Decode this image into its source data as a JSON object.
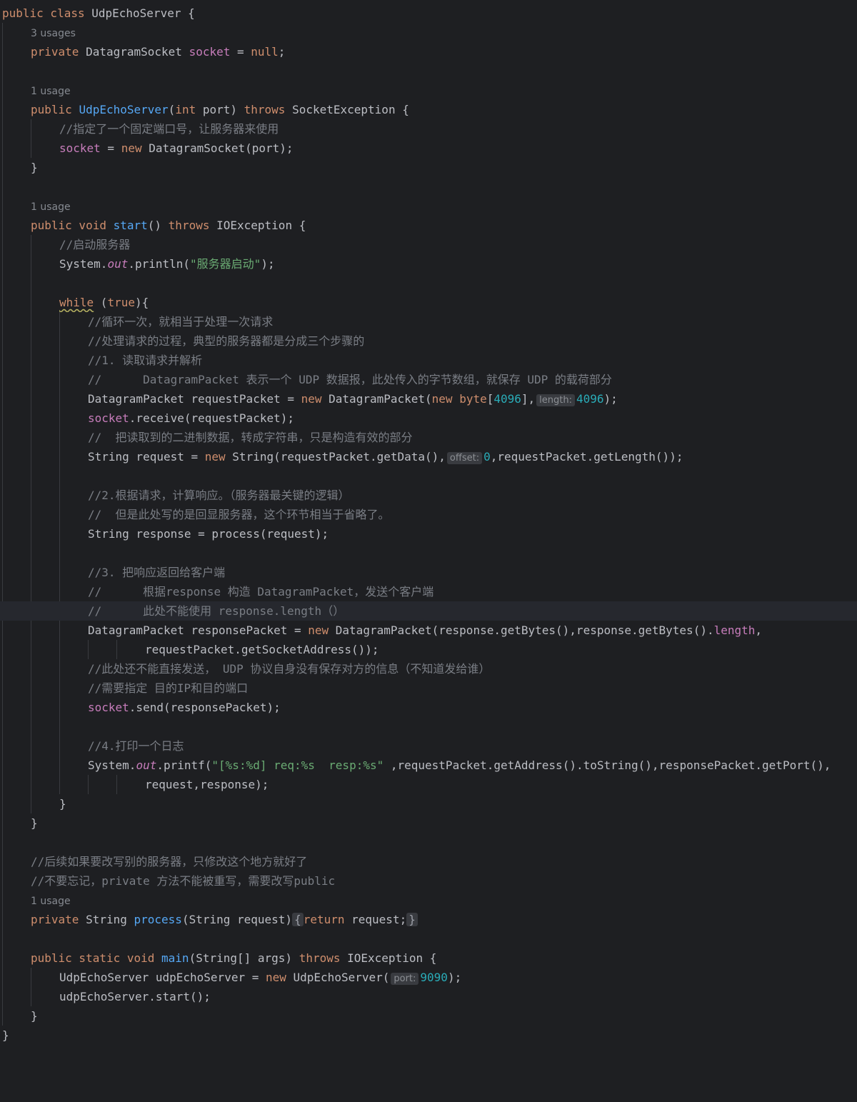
{
  "editor": {
    "lines": [
      {
        "indent": 0,
        "tokens": [
          {
            "t": "public class ",
            "c": "k"
          },
          {
            "t": "UdpEchoServer {"
          }
        ]
      },
      {
        "indent": 1,
        "usage": "3 usages"
      },
      {
        "indent": 1,
        "tokens": [
          {
            "t": "private ",
            "c": "k"
          },
          {
            "t": "DatagramSocket "
          },
          {
            "t": "socket",
            "c": "fd"
          },
          {
            "t": " = "
          },
          {
            "t": "null",
            "c": "k"
          },
          {
            "t": ";"
          }
        ]
      },
      {
        "indent": 0,
        "tokens": []
      },
      {
        "indent": 1,
        "usage": "1 usage"
      },
      {
        "indent": 1,
        "tokens": [
          {
            "t": "public ",
            "c": "k"
          },
          {
            "t": "UdpEchoServer",
            "c": "f"
          },
          {
            "t": "("
          },
          {
            "t": "int ",
            "c": "k"
          },
          {
            "t": "port) "
          },
          {
            "t": "throws ",
            "c": "k"
          },
          {
            "t": "SocketException {"
          }
        ]
      },
      {
        "indent": 2,
        "tokens": [
          {
            "t": "//指定了一个固定端口号，让服务器来使用",
            "c": "c"
          }
        ]
      },
      {
        "indent": 2,
        "tokens": [
          {
            "t": "socket",
            "c": "fd"
          },
          {
            "t": " = "
          },
          {
            "t": "new ",
            "c": "k"
          },
          {
            "t": "DatagramSocket(port);"
          }
        ]
      },
      {
        "indent": 1,
        "tokens": [
          {
            "t": "}"
          }
        ]
      },
      {
        "indent": 0,
        "tokens": []
      },
      {
        "indent": 1,
        "usage": "1 usage"
      },
      {
        "indent": 1,
        "tokens": [
          {
            "t": "public void ",
            "c": "k"
          },
          {
            "t": "start",
            "c": "f"
          },
          {
            "t": "() "
          },
          {
            "t": "throws ",
            "c": "k"
          },
          {
            "t": "IOException {"
          }
        ]
      },
      {
        "indent": 2,
        "tokens": [
          {
            "t": "//启动服务器",
            "c": "c"
          }
        ]
      },
      {
        "indent": 2,
        "tokens": [
          {
            "t": "System."
          },
          {
            "t": "out",
            "c": "st"
          },
          {
            "t": ".println("
          },
          {
            "t": "\"服务器启动\"",
            "c": "s"
          },
          {
            "t": ");"
          }
        ]
      },
      {
        "indent": 0,
        "tokens": []
      },
      {
        "indent": 2,
        "tokens": [
          {
            "t": "while",
            "c": "k",
            "u": true
          },
          {
            "t": " ("
          },
          {
            "t": "true",
            "c": "k"
          },
          {
            "t": "){"
          }
        ]
      },
      {
        "indent": 3,
        "tokens": [
          {
            "t": "//循环一次，就相当于处理一次请求",
            "c": "c"
          }
        ]
      },
      {
        "indent": 3,
        "tokens": [
          {
            "t": "//处理请求的过程，典型的服务器都是分成三个步骤的",
            "c": "c"
          }
        ]
      },
      {
        "indent": 3,
        "tokens": [
          {
            "t": "//1. 读取请求并解析",
            "c": "c"
          }
        ]
      },
      {
        "indent": 3,
        "tokens": [
          {
            "t": "//      DatagramPacket 表示一个 UDP 数据报，此处传入的字节数组，就保存 UDP 的载荷部分",
            "c": "c"
          }
        ]
      },
      {
        "indent": 3,
        "tokens": [
          {
            "t": "DatagramPacket requestPacket = "
          },
          {
            "t": "new ",
            "c": "k"
          },
          {
            "t": "DatagramPacket("
          },
          {
            "t": "new byte",
            "c": "k"
          },
          {
            "t": "["
          },
          {
            "t": "4096",
            "c": "n"
          },
          {
            "t": "],"
          },
          {
            "h": "length:"
          },
          {
            "t": "4096",
            "c": "n"
          },
          {
            "t": ");"
          }
        ]
      },
      {
        "indent": 3,
        "tokens": [
          {
            "t": "socket",
            "c": "fd"
          },
          {
            "t": ".receive(requestPacket);"
          }
        ]
      },
      {
        "indent": 3,
        "tokens": [
          {
            "t": "//  把读取到的二进制数据，转成字符串，只是构造有效的部分",
            "c": "c"
          }
        ]
      },
      {
        "indent": 3,
        "tokens": [
          {
            "t": "String request = "
          },
          {
            "t": "new ",
            "c": "k"
          },
          {
            "t": "String(requestPacket.getData(),"
          },
          {
            "h": "offset:"
          },
          {
            "t": "0",
            "c": "n"
          },
          {
            "t": ",requestPacket.getLength());"
          }
        ]
      },
      {
        "indent": 0,
        "tokens": []
      },
      {
        "indent": 3,
        "tokens": [
          {
            "t": "//2.根据请求，计算响应。（服务器最关键的逻辑）",
            "c": "c"
          }
        ]
      },
      {
        "indent": 3,
        "tokens": [
          {
            "t": "//  但是此处写的是回显服务器，这个环节相当于省略了。",
            "c": "c"
          }
        ]
      },
      {
        "indent": 3,
        "tokens": [
          {
            "t": "String response = process(request);"
          }
        ]
      },
      {
        "indent": 0,
        "tokens": []
      },
      {
        "indent": 3,
        "tokens": [
          {
            "t": "//3. 把响应返回给客户端",
            "c": "c"
          }
        ]
      },
      {
        "indent": 3,
        "tokens": [
          {
            "t": "//      根据response 构造 DatagramPacket，发送个客户端",
            "c": "c"
          }
        ]
      },
      {
        "indent": 3,
        "tokens": [
          {
            "t": "//      此处不能使用 response.length（）",
            "c": "c"
          }
        ],
        "current": true
      },
      {
        "indent": 3,
        "tokens": [
          {
            "t": "DatagramPacket responsePacket = "
          },
          {
            "t": "new ",
            "c": "k"
          },
          {
            "t": "DatagramPacket(response.getBytes(),response.getBytes()."
          },
          {
            "t": "length",
            "c": "fd"
          },
          {
            "t": ","
          }
        ]
      },
      {
        "indent": 5,
        "tokens": [
          {
            "t": "requestPacket.getSocketAddress());"
          }
        ]
      },
      {
        "indent": 3,
        "tokens": [
          {
            "t": "//此处还不能直接发送， UDP 协议自身没有保存对方的信息（不知道发给谁）",
            "c": "c"
          }
        ]
      },
      {
        "indent": 3,
        "tokens": [
          {
            "t": "//需要指定 目的IP和目的端口",
            "c": "c"
          }
        ]
      },
      {
        "indent": 3,
        "tokens": [
          {
            "t": "socket",
            "c": "fd"
          },
          {
            "t": ".send(responsePacket);"
          }
        ]
      },
      {
        "indent": 0,
        "tokens": []
      },
      {
        "indent": 3,
        "tokens": [
          {
            "t": "//4.打印一个日志",
            "c": "c"
          }
        ]
      },
      {
        "indent": 3,
        "tokens": [
          {
            "t": "System."
          },
          {
            "t": "out",
            "c": "st"
          },
          {
            "t": ".printf("
          },
          {
            "t": "\"[%s:%d] req:%s  resp:%s\"",
            "c": "s"
          },
          {
            "t": " ,requestPacket.getAddress().toString(),responsePacket.getPort(),"
          }
        ]
      },
      {
        "indent": 5,
        "tokens": [
          {
            "t": "request,response);"
          }
        ]
      },
      {
        "indent": 2,
        "tokens": [
          {
            "t": "}"
          }
        ]
      },
      {
        "indent": 1,
        "tokens": [
          {
            "t": "}"
          }
        ]
      },
      {
        "indent": 0,
        "tokens": []
      },
      {
        "indent": 1,
        "tokens": [
          {
            "t": "//后续如果要改写别的服务器，只修改这个地方就好了",
            "c": "c"
          }
        ]
      },
      {
        "indent": 1,
        "tokens": [
          {
            "t": "//不要忘记，private 方法不能被重写，需要改写public",
            "c": "c"
          }
        ]
      },
      {
        "indent": 1,
        "usage": "1 usage"
      },
      {
        "indent": 1,
        "tokens": [
          {
            "t": "private ",
            "c": "k"
          },
          {
            "t": "String "
          },
          {
            "t": "process",
            "c": "f"
          },
          {
            "t": "(String request)"
          },
          {
            "fold": "{"
          },
          {
            "t": "return ",
            "c": "k"
          },
          {
            "t": "request;"
          },
          {
            "fold": "}"
          }
        ]
      },
      {
        "indent": 0,
        "tokens": []
      },
      {
        "indent": 1,
        "tokens": [
          {
            "t": "public static void ",
            "c": "k"
          },
          {
            "t": "main",
            "c": "f"
          },
          {
            "t": "(String[] args) "
          },
          {
            "t": "throws ",
            "c": "k"
          },
          {
            "t": "IOException {"
          }
        ]
      },
      {
        "indent": 2,
        "tokens": [
          {
            "t": "UdpEchoServer udpEchoServer = "
          },
          {
            "t": "new ",
            "c": "k"
          },
          {
            "t": "UdpEchoServer("
          },
          {
            "h": "port:"
          },
          {
            "t": "9090",
            "c": "n"
          },
          {
            "t": ");"
          }
        ]
      },
      {
        "indent": 2,
        "tokens": [
          {
            "t": "udpEchoServer.start();"
          }
        ]
      },
      {
        "indent": 1,
        "tokens": [
          {
            "t": "}"
          }
        ]
      },
      {
        "indent": 0,
        "tokens": [
          {
            "t": "}"
          }
        ]
      }
    ]
  }
}
